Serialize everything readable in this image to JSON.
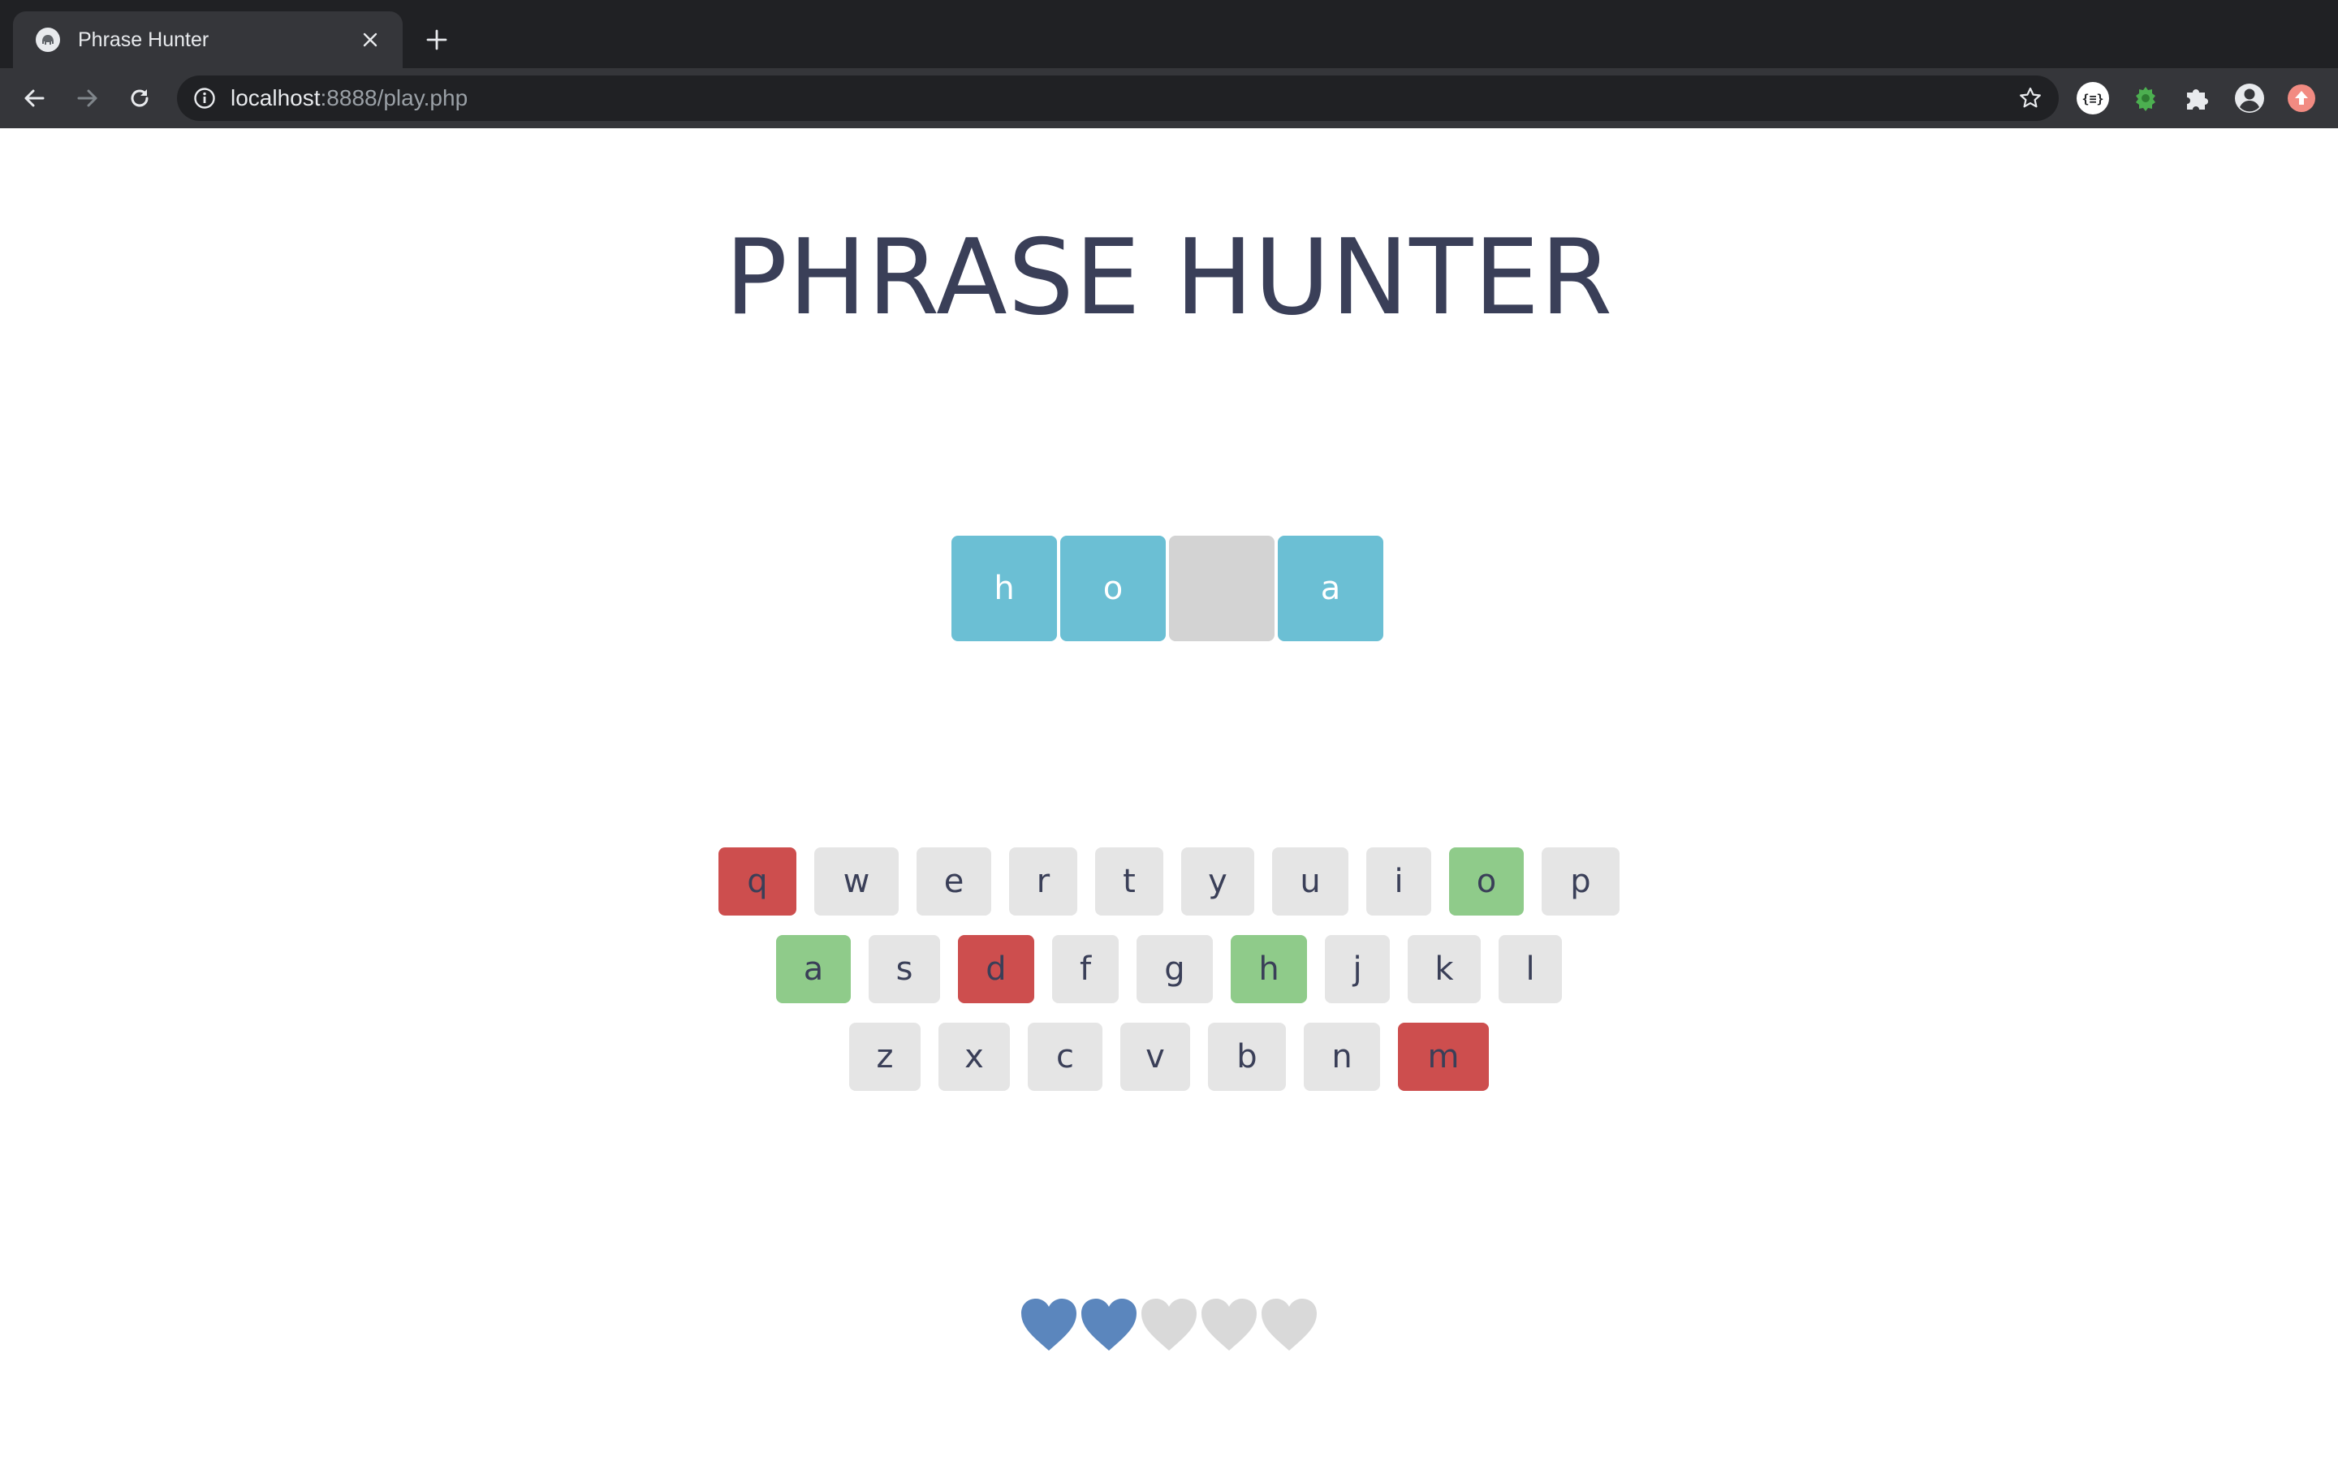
{
  "browser": {
    "tab_title": "Phrase Hunter",
    "url_host": "localhost",
    "url_rest": ":8888/play.php",
    "icons": {
      "favicon": "elephant-favicon-icon",
      "close": "close-icon",
      "new_tab": "plus-icon",
      "back": "arrow-left-icon",
      "forward": "arrow-right-icon",
      "reload": "reload-icon",
      "info": "info-icon",
      "bookmark": "star-icon",
      "ext_json": "json-braces-icon",
      "ext_bug": "bug-icon",
      "extensions": "puzzle-icon",
      "profile": "account-circle-icon",
      "update": "update-arrow-icon"
    }
  },
  "game": {
    "title": "PHRASE HUNTER",
    "phrase": [
      {
        "char": "h",
        "kind": "letter"
      },
      {
        "char": "o",
        "kind": "letter"
      },
      {
        "char": "",
        "kind": "space"
      },
      {
        "char": "a",
        "kind": "letter"
      }
    ],
    "keyboard": [
      [
        {
          "key": "q",
          "state": "wrong"
        },
        {
          "key": "w",
          "state": "unused"
        },
        {
          "key": "e",
          "state": "unused"
        },
        {
          "key": "r",
          "state": "unused"
        },
        {
          "key": "t",
          "state": "unused"
        },
        {
          "key": "y",
          "state": "unused"
        },
        {
          "key": "u",
          "state": "unused"
        },
        {
          "key": "i",
          "state": "unused"
        },
        {
          "key": "o",
          "state": "correct"
        },
        {
          "key": "p",
          "state": "unused"
        }
      ],
      [
        {
          "key": "a",
          "state": "correct"
        },
        {
          "key": "s",
          "state": "unused"
        },
        {
          "key": "d",
          "state": "wrong"
        },
        {
          "key": "f",
          "state": "unused"
        },
        {
          "key": "g",
          "state": "unused"
        },
        {
          "key": "h",
          "state": "correct"
        },
        {
          "key": "j",
          "state": "unused"
        },
        {
          "key": "k",
          "state": "unused"
        },
        {
          "key": "l",
          "state": "unused"
        }
      ],
      [
        {
          "key": "z",
          "state": "unused"
        },
        {
          "key": "x",
          "state": "unused"
        },
        {
          "key": "c",
          "state": "unused"
        },
        {
          "key": "v",
          "state": "unused"
        },
        {
          "key": "b",
          "state": "unused"
        },
        {
          "key": "n",
          "state": "unused"
        },
        {
          "key": "m",
          "state": "wrong"
        }
      ]
    ],
    "lives": {
      "total": 5,
      "remaining": 2,
      "icon": "heart-icon"
    },
    "colors": {
      "title": "#3a3f58",
      "phrase_letter": "#6bbfd4",
      "phrase_space": "#d3d3d3",
      "key_unused": "#e5e5e5",
      "key_correct": "#8fcb8a",
      "key_wrong": "#cd4e4e",
      "heart_full": "#5b86bd",
      "heart_lost": "#d9d9d9"
    }
  }
}
